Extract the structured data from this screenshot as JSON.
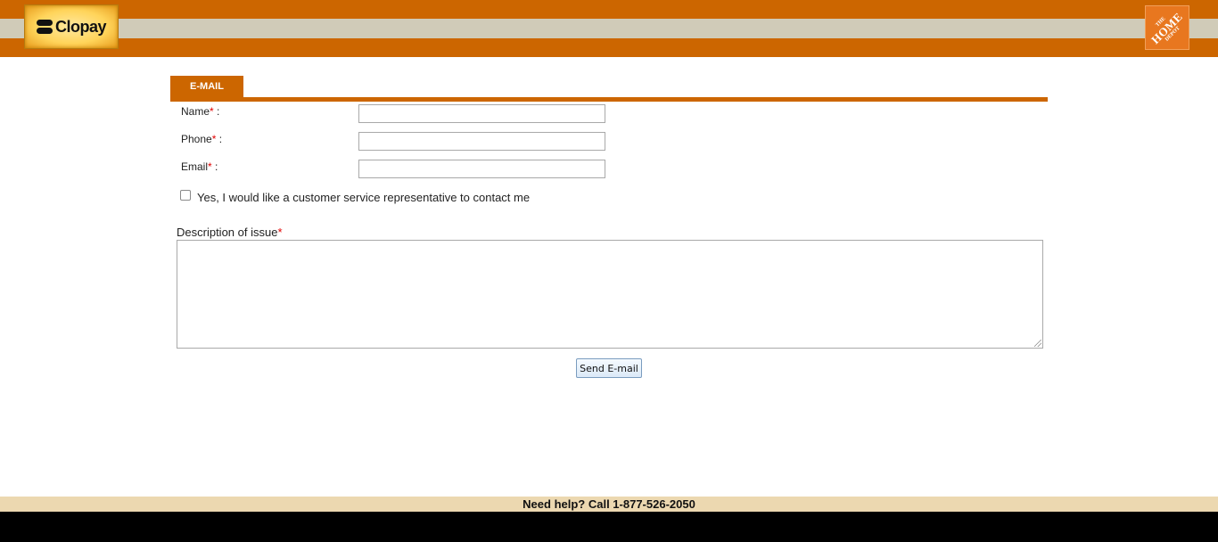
{
  "header": {
    "brand_name": "Clopay",
    "partner_logo": {
      "small_text": "THE",
      "big_text": "HOME",
      "bottom_text": "DEPOT"
    },
    "colors": {
      "primary": "#cc6600",
      "stripe": "#d0cbb8"
    }
  },
  "tab": {
    "label": "E-MAIL"
  },
  "form": {
    "name_label": "Name",
    "phone_label": "Phone",
    "email_label": "Email",
    "required_marker": "*",
    "label_suffix": " :",
    "name_value": "",
    "phone_value": "",
    "email_value": "",
    "contact_checkbox_label": "Yes, I would like a customer service representative to contact me",
    "contact_checked": false,
    "description_label": "Description of issue",
    "description_value": "",
    "submit_label": "Send E-mail"
  },
  "footer": {
    "help_text": "Need help? Call 1-877-526-2050"
  }
}
